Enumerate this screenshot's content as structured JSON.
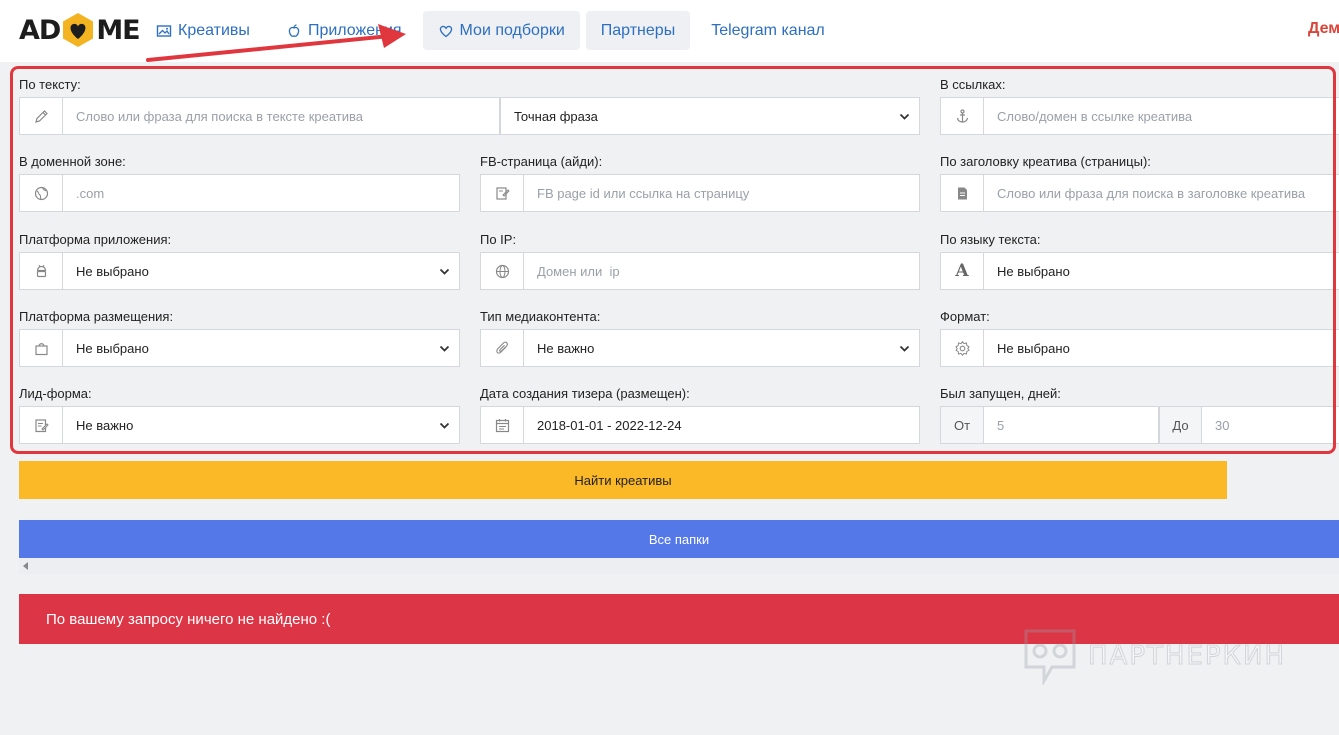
{
  "header": {
    "logo_left": "AD",
    "logo_right": "ME",
    "nav": [
      {
        "label": "Креативы",
        "icon": "image-icon"
      },
      {
        "label": "Приложения",
        "icon": "apple-icon"
      },
      {
        "label": "Мои подборки",
        "icon": "heart-icon"
      },
      {
        "label": "Партнеры",
        "icon": ""
      },
      {
        "label": "Telegram канал",
        "icon": ""
      }
    ],
    "user_link": "Дем"
  },
  "filters": {
    "text": {
      "label": "По тексту:",
      "placeholder": "Слово или фраза для поиска в тексте креатива",
      "mode": "Точная фраза"
    },
    "links": {
      "label": "В ссылках:",
      "placeholder": "Слово/домен в ссылке креатива"
    },
    "domain_zone": {
      "label": "В доменной зоне:",
      "placeholder": ".com"
    },
    "fb_page": {
      "label": "FB-страница (айди):",
      "placeholder": "FB page id или ссылка на страницу"
    },
    "title": {
      "label": "По заголовку креатива (страницы):",
      "placeholder": "Слово или фраза для поиска в заголовке креатива"
    },
    "app_platform": {
      "label": "Платформа приложения:",
      "value": "Не выбрано"
    },
    "ip": {
      "label": "По IP:",
      "placeholder": "Домен или  ip"
    },
    "language": {
      "label": "По языку текста:",
      "value": "Не выбрано"
    },
    "placement": {
      "label": "Платформа размещения:",
      "value": "Не выбрано"
    },
    "media_type": {
      "label": "Тип медиаконтента:",
      "value": "Не важно"
    },
    "format": {
      "label": "Формат:",
      "value": "Не выбрано"
    },
    "lead_form": {
      "label": "Лид-форма:",
      "value": "Не важно"
    },
    "created": {
      "label": "Дата создания тизера (размещен):",
      "value": "2018-01-01 - 2022-12-24"
    },
    "days": {
      "label": "Был запущен, дней:",
      "from_label": "От",
      "from_placeholder": "5",
      "to_label": "До",
      "to_placeholder": "30"
    }
  },
  "actions": {
    "find_label": "Найти креативы",
    "folders_label": "Все папки"
  },
  "alert_text": "По вашему запросу ничего не найдено :(",
  "watermark_text": "ПАРТНЕРКИН",
  "colors": {
    "accent_yellow": "#fbb827",
    "accent_blue": "#5478e8",
    "alert_red": "#dc3545",
    "link_blue": "#2d6fc0",
    "annotation_red": "#e0373f"
  }
}
